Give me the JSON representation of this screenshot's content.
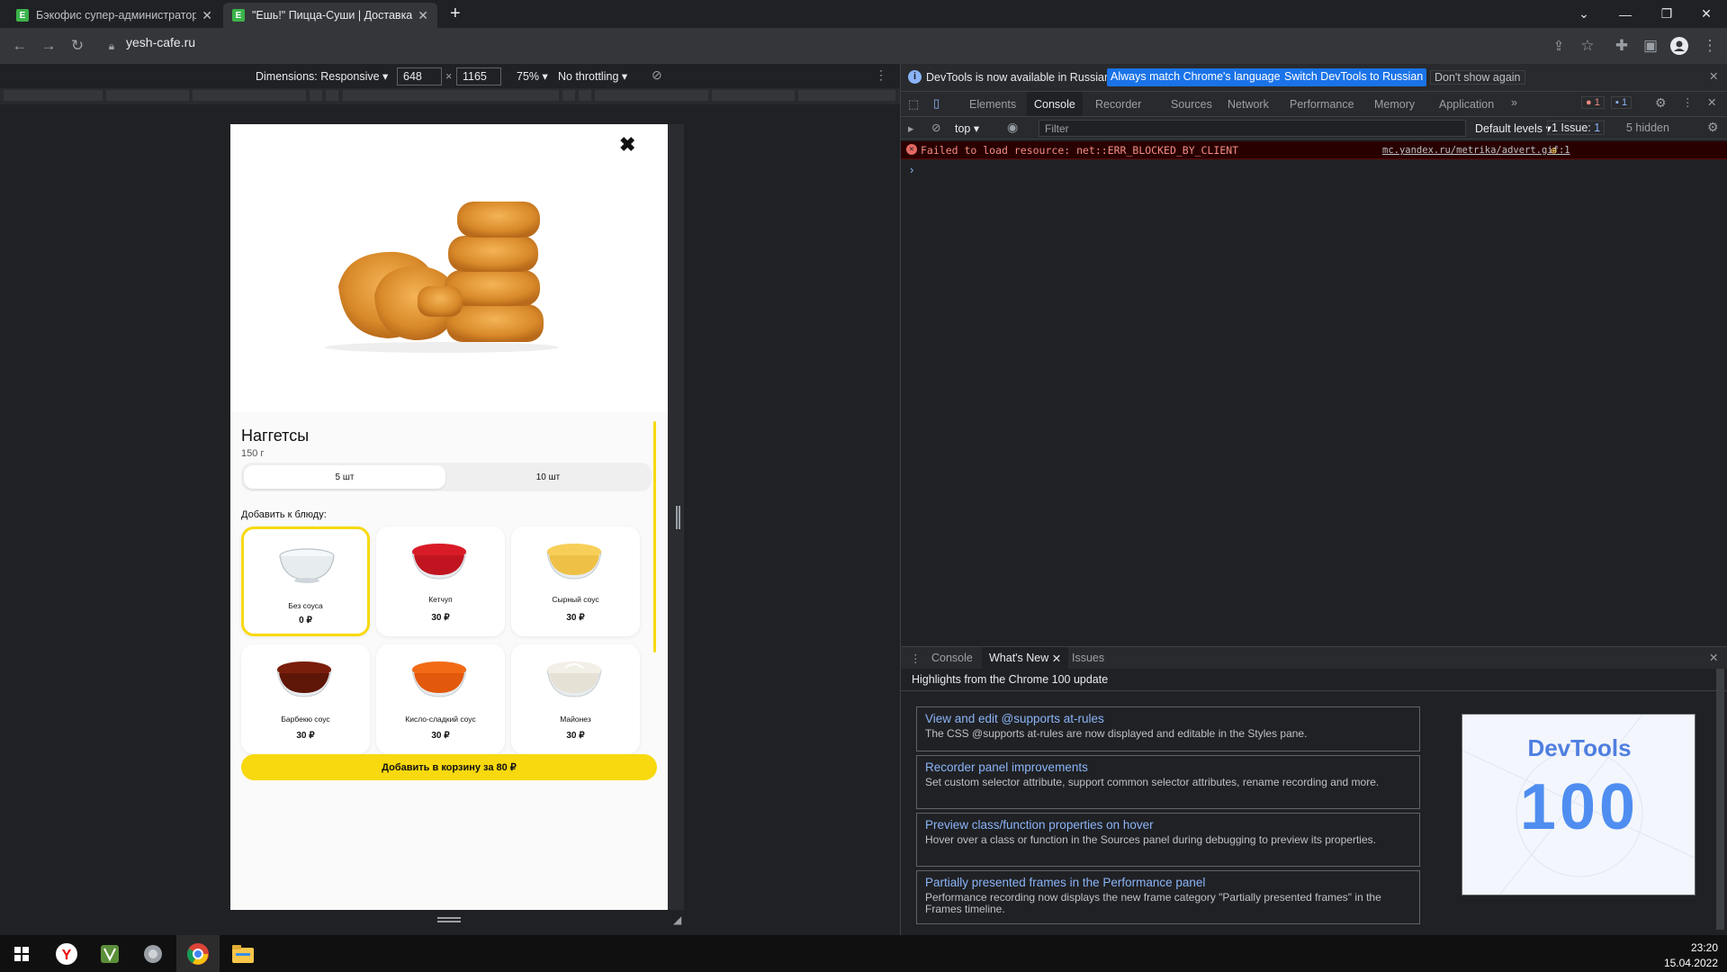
{
  "browser": {
    "tabs": [
      {
        "title": "Бэкофис супер-администратора",
        "active": false
      },
      {
        "title": "\"Ешь!\" Пицца-Суши | Доставка",
        "active": true
      }
    ],
    "new_tab": "+",
    "url": "yesh-cafe.ru"
  },
  "device_toolbar": {
    "dimensions_label": "Dimensions: Responsive",
    "width": "648",
    "times": "×",
    "height": "1165",
    "zoom": "75%",
    "throttling": "No throttling"
  },
  "product": {
    "close": "✖",
    "title": "Наггетсы",
    "weight": "150 г",
    "options": [
      "5 шт",
      "10 шт"
    ],
    "selected_option": 0,
    "add_label": "Добавить к блюду:",
    "addons": [
      {
        "name": "Без соуса",
        "price": "0 ₽",
        "selected": true,
        "color": "#eef2f4"
      },
      {
        "name": "Кетчуп",
        "price": "30 ₽",
        "selected": false,
        "color": "#d81b27"
      },
      {
        "name": "Сырный соус",
        "price": "30 ₽",
        "selected": false,
        "color": "#f7cf58"
      },
      {
        "name": "Барбекю соус",
        "price": "30 ₽",
        "selected": false,
        "color": "#7a1e0c"
      },
      {
        "name": "Кисло-сладкий соус",
        "price": "30 ₽",
        "selected": false,
        "color": "#f36a16"
      },
      {
        "name": "Майонез",
        "price": "30 ₽",
        "selected": false,
        "color": "#f2efe6"
      }
    ],
    "cart_button": "Добавить в корзину за 80 ₽",
    "accent": "#f8d90f"
  },
  "devtools": {
    "info_text": "DevTools is now available in Russian!",
    "btn_match": "Always match Chrome's language",
    "btn_switch": "Switch DevTools to Russian",
    "btn_dismiss": "Don't show again",
    "tabs": [
      "Elements",
      "Console",
      "Recorder",
      "Sources",
      "Network",
      "Performance",
      "Memory",
      "Application"
    ],
    "active_tab": "Console",
    "error_count": "1",
    "message_count": "1",
    "context": "top",
    "filter_placeholder": "Filter",
    "levels": "Default levels",
    "issues": "1 Issue:",
    "issues_count": "1",
    "hidden": "5 hidden",
    "error_message": "Failed to load resource: net::ERR_BLOCKED_BY_CLIENT",
    "error_source": "mc.yandex.ru/metrika/advert.gif:1",
    "prompt": "›",
    "drawer_tabs": [
      "Console",
      "What's New",
      "Issues"
    ],
    "drawer_active": "What's New",
    "highlights_title": "Highlights from the Chrome 100 update",
    "features": [
      {
        "title": "View and edit @supports at-rules",
        "desc": "The CSS @supports at-rules are now displayed and editable in the Styles pane."
      },
      {
        "title": "Recorder panel improvements",
        "desc": "Set custom selector attribute, support common selector attributes, rename recording and more."
      },
      {
        "title": "Preview class/function properties on hover",
        "desc": "Hover over a class or function in the Sources panel during debugging to preview its properties."
      },
      {
        "title": "Partially presented frames in the Performance panel",
        "desc": "Performance recording now displays the new frame category \"Partially presented frames\" in the Frames timeline."
      }
    ],
    "promo_title": "DevTools",
    "promo_number": "100"
  },
  "taskbar": {
    "time": "23:20",
    "date": "15.04.2022"
  }
}
